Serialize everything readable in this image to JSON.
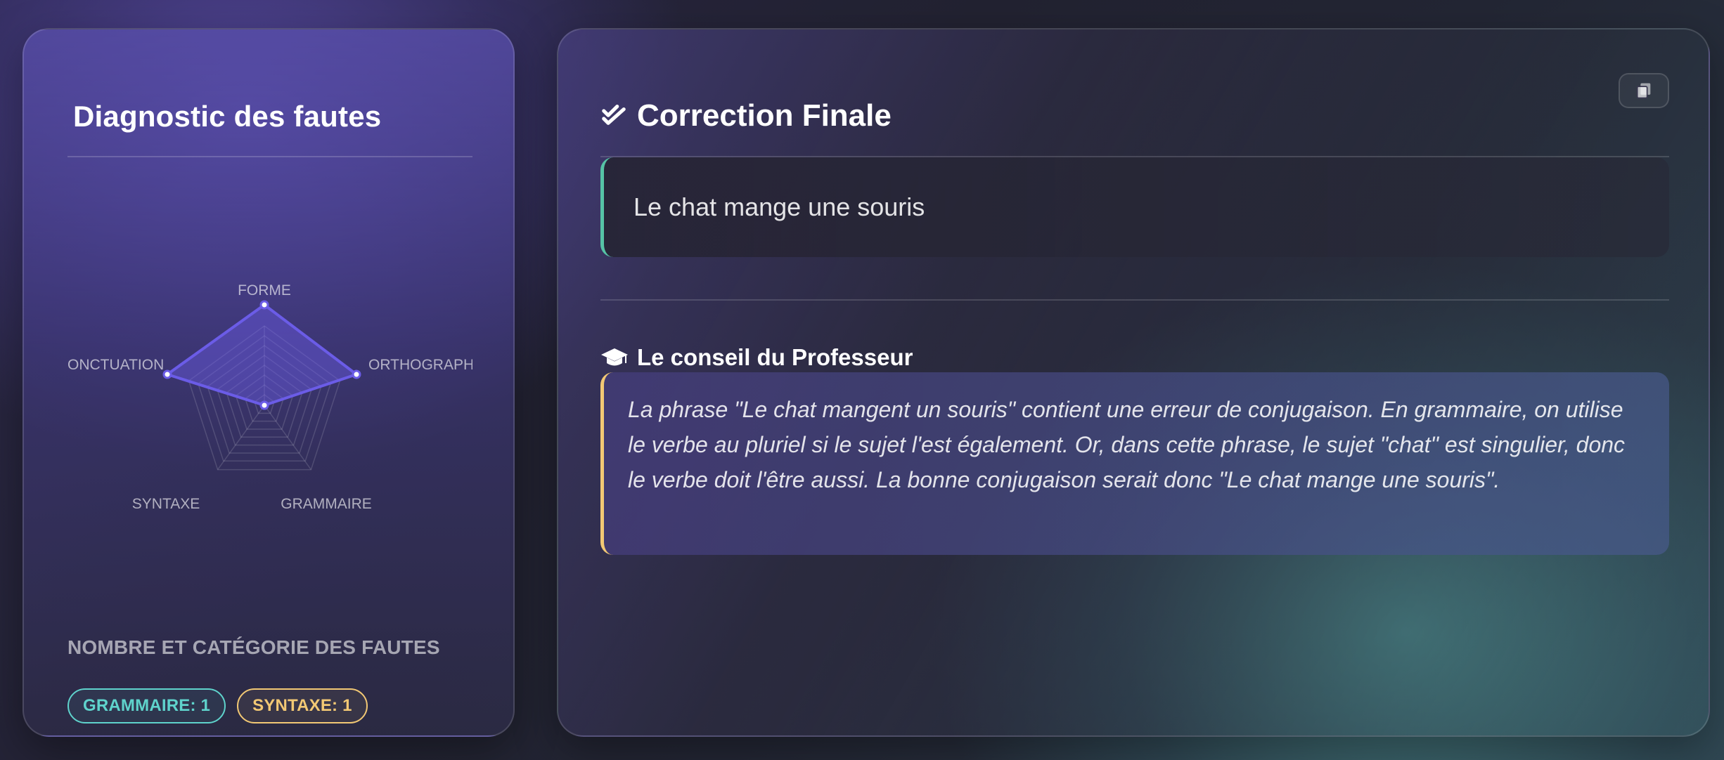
{
  "diagnostic": {
    "title": "Diagnostic des fautes",
    "radar": {
      "axes": [
        "FORME",
        "ORTHOGRAPHE",
        "GRAMMAIRE",
        "SYNTAXE",
        "PONCTUATION"
      ],
      "axis_labels_visible": [
        "FORME",
        "ORTHOGRAPH",
        "GRAMMAIRE",
        "SYNTAXE",
        "ONCTUATION"
      ],
      "accent_color": "#6b5ce7"
    },
    "counts_heading": "NOMBRE ET CATÉGORIE DES FAUTES",
    "badges": [
      {
        "label": "GRAMMAIRE: 1",
        "color": "#5fd3cc"
      },
      {
        "label": "SYNTAXE: 1",
        "color": "#f2c874"
      }
    ]
  },
  "correction": {
    "title": "Correction Finale",
    "title_icon": "double-check-icon",
    "copy_icon": "copy-icon",
    "corrected_text": "Le chat mange une souris",
    "tip": {
      "title": "Le conseil du Professeur",
      "icon": "graduation-cap-icon",
      "text": "La phrase \"Le chat mangent un souris\" contient une erreur de conjugaison. En grammaire, on utilise le verbe au pluriel si le sujet l'est également. Or, dans cette phrase, le sujet \"chat\" est singulier, donc le verbe doit l'être aussi. La bonne conjugaison serait donc \"Le chat mange une souris\"."
    },
    "colors": {
      "correct_accent": "#56c3a6",
      "tip_accent": "#f2c874"
    }
  }
}
